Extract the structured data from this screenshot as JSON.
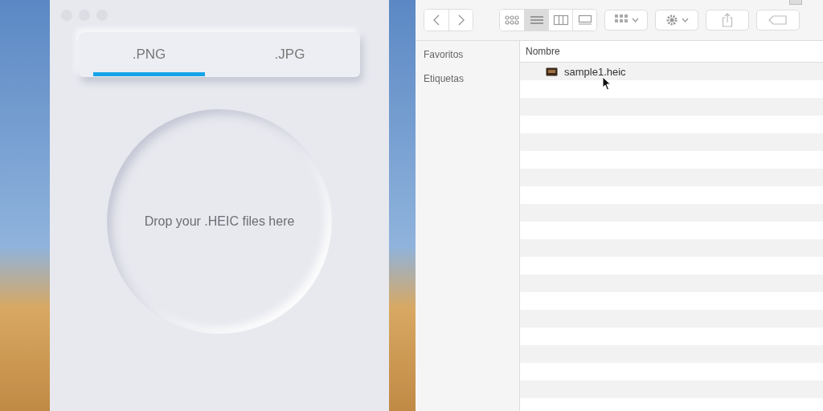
{
  "converter": {
    "tabs": [
      {
        "label": ".PNG",
        "selected": true
      },
      {
        "label": ".JPG",
        "selected": false
      }
    ],
    "drop_zone": {
      "text": "Drop your .HEIC files here"
    }
  },
  "finder": {
    "view_modes": [
      {
        "kind": "icons",
        "selected": false
      },
      {
        "kind": "list",
        "selected": true
      },
      {
        "kind": "columns",
        "selected": false
      },
      {
        "kind": "gallery",
        "selected": false
      }
    ],
    "sidebar": [
      "Favoritos",
      "Etiquetas"
    ],
    "column": "Nombre",
    "files": [
      {
        "name": "sample1.heic"
      }
    ]
  }
}
